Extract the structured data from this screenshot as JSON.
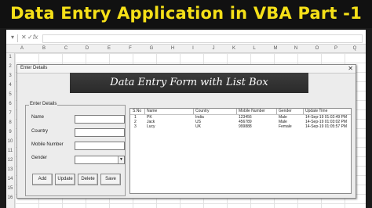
{
  "banner": {
    "title": "Data Entry Application in VBA Part -1"
  },
  "excel": {
    "name_box_icon": "x-icon",
    "fx_label": "fx",
    "columns": [
      "A",
      "B",
      "C",
      "D",
      "E",
      "F",
      "G",
      "H",
      "I",
      "J",
      "K",
      "L",
      "M",
      "N",
      "O",
      "P",
      "Q"
    ],
    "rows": [
      "1",
      "2",
      "3",
      "4",
      "5",
      "6",
      "7",
      "8",
      "9",
      "10",
      "11",
      "12",
      "13",
      "14",
      "15",
      "16"
    ]
  },
  "form": {
    "window_title": "Enter Details",
    "header": "Data Entry Form with List Box",
    "frame_caption": "Enter Details",
    "labels": {
      "name": "Name",
      "country": "Country",
      "mobile": "Mobile Number",
      "gender": "Gender"
    },
    "buttons": {
      "add": "Add",
      "update": "Update",
      "delete": "Delete",
      "save": "Save"
    },
    "listbox": {
      "columns": [
        "S.No",
        "Name",
        "Country",
        "Mobile Number",
        "Gender",
        "Update Time"
      ],
      "rows": [
        [
          "1",
          "PK",
          "India",
          "123456",
          "Male",
          "14-Sep-19 01:02:49 PM"
        ],
        [
          "2",
          "Jack",
          "US",
          "456789",
          "Male",
          "14-Sep-19 01:03:02 PM"
        ],
        [
          "3",
          "Lucy",
          "UK",
          "999888",
          "Female",
          "14-Sep-19 01:05:57 PM"
        ]
      ]
    }
  }
}
